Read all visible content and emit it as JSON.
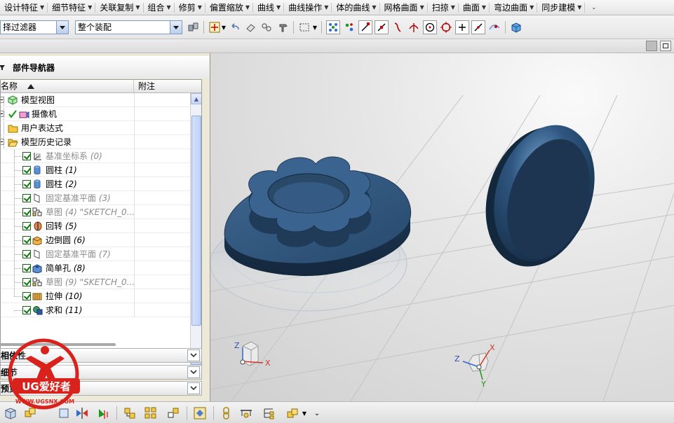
{
  "menu": {
    "items": [
      {
        "label": "设计特征"
      },
      {
        "label": "细节特征"
      },
      {
        "label": "关联复制"
      },
      {
        "label": "组合"
      },
      {
        "label": "修剪"
      },
      {
        "label": "偏置缩放"
      },
      {
        "label": "曲线"
      },
      {
        "label": "曲线操作"
      },
      {
        "label": "体的曲线"
      },
      {
        "label": "网格曲面"
      },
      {
        "label": "扫掠"
      },
      {
        "label": "曲面"
      },
      {
        "label": "弯边曲面"
      },
      {
        "label": "同步建模"
      }
    ]
  },
  "toolbar": {
    "filter_value": "择过滤器",
    "assembly_value": "整个装配"
  },
  "navigator": {
    "title": "部件导航器",
    "col_name": "名称",
    "col_note": "附注",
    "rows": [
      {
        "label": "模型视图",
        "num": ""
      },
      {
        "label": "摄像机",
        "num": ""
      },
      {
        "label": "用户表达式",
        "num": ""
      },
      {
        "label": "模型历史记录",
        "num": ""
      },
      {
        "label": "基准坐标系",
        "num": "(0)"
      },
      {
        "label": "圆柱",
        "num": "(1)"
      },
      {
        "label": "圆柱",
        "num": "(2)"
      },
      {
        "label": "固定基准平面",
        "num": "(3)"
      },
      {
        "label": "草图",
        "num": "(4) \"SKETCH_0..."
      },
      {
        "label": "回转",
        "num": "(5)"
      },
      {
        "label": "边倒圆",
        "num": "(6)"
      },
      {
        "label": "固定基准平面",
        "num": "(7)"
      },
      {
        "label": "简单孔",
        "num": "(8)"
      },
      {
        "label": "草图",
        "num": "(9) \"SKETCH_0..."
      },
      {
        "label": "拉伸",
        "num": "(10)"
      },
      {
        "label": "求和",
        "num": "(11)"
      }
    ],
    "panels": [
      {
        "label": "相依性"
      },
      {
        "label": "细节"
      },
      {
        "label": "预览"
      }
    ]
  },
  "viewport": {
    "triad_left": {
      "z": "Z",
      "x": "X"
    },
    "triad_right": {
      "z": "Z",
      "x": "X",
      "y": "Y"
    }
  },
  "logo": {
    "brand": "UG爱好者",
    "url": "WWW.UGSNX.COM"
  },
  "colors": {
    "part_blue": "#2d5278",
    "logo_red": "#d9221c"
  }
}
